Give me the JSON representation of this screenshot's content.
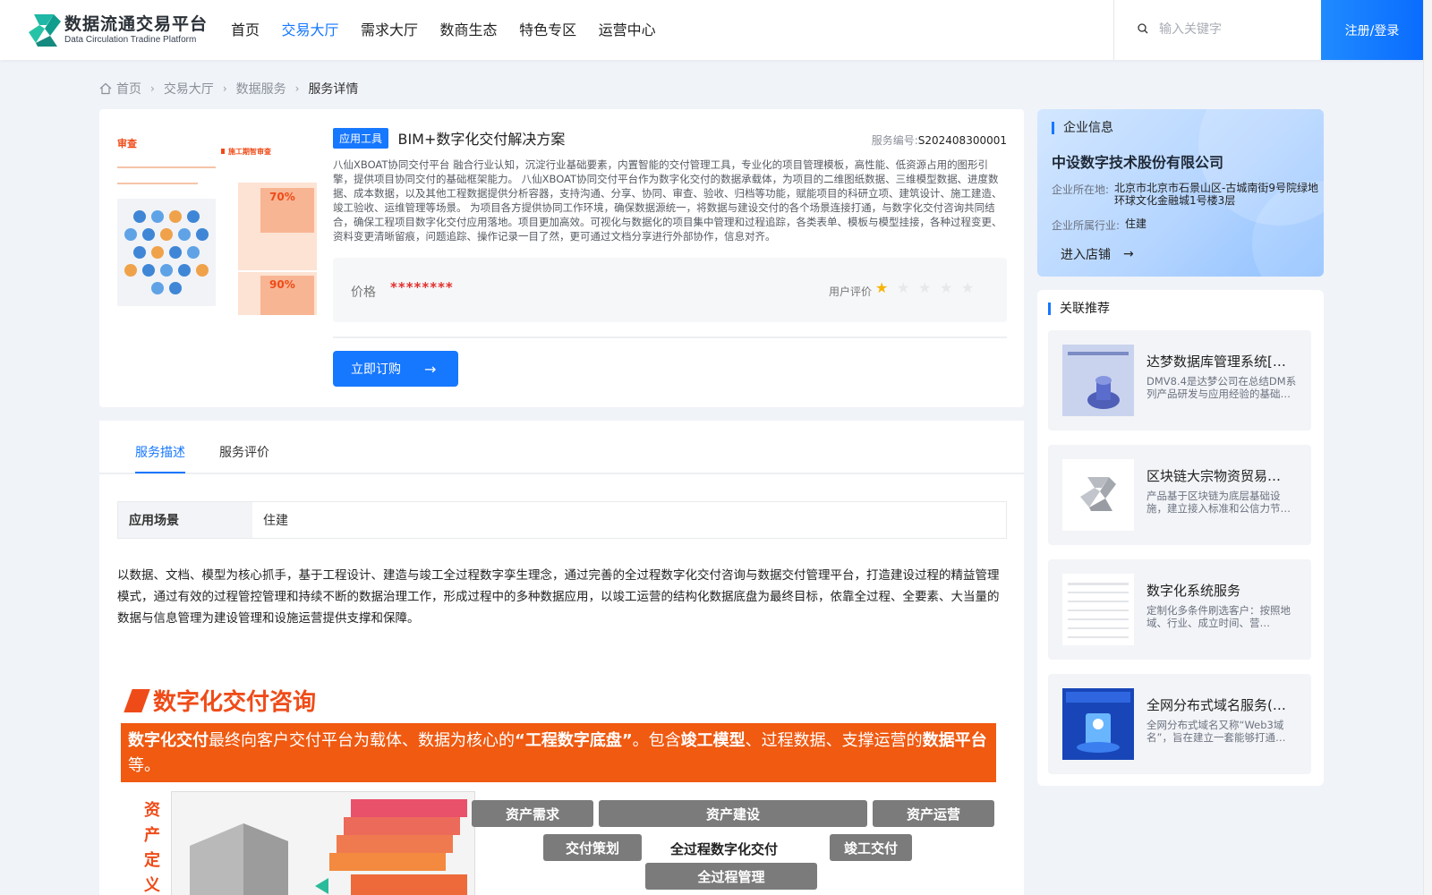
{
  "header": {
    "logo_title": "数据流通交易平台",
    "logo_subtitle": "Data Circulation Tradine Platform",
    "nav": [
      {
        "label": "首页",
        "active": false
      },
      {
        "label": "交易大厅",
        "active": true
      },
      {
        "label": "需求大厅",
        "active": false
      },
      {
        "label": "数商生态",
        "active": false
      },
      {
        "label": "特色专区",
        "active": false
      },
      {
        "label": "运营中心",
        "active": false
      }
    ],
    "search_placeholder": "输入关键字",
    "login_label": "注册/登录",
    "accent_color": "#1677ff"
  },
  "breadcrumb": [
    "首页",
    "交易大厅",
    "数据服务",
    "服务详情"
  ],
  "product": {
    "tag": "应用工具",
    "title": "BIM+数字化交付解决方案",
    "service_no_label": "服务编号:",
    "service_no": "S202408300001",
    "description": "八仙XBOAT协同交付平台 融合行业认知，沉淀行业基础要素，内置智能的交付管理工具，专业化的项目管理模板，高性能、低资源占用的图形引擎，提供项目协同交付的基础框架能力。 八仙XBOAT协同交付平台作为数字化交付的数据承载体，为项目的二维图纸数据、三维模型数据、进度数据、成本数据，以及其他工程数据提供分析容器，支持沟通、分享、协同、审查、验收、归档等功能，赋能项目的科研立项、建筑设计、施工建造、竣工验收、运维管理等场景。 为项目各方提供协同工作环境，确保数据源统一，将数据与建设交付的各个场景连接打通，与数字化交付咨询共同结合，确保工程项目数字化交付应用落地。项目更加高效。可视化与数据化的项目集中管理和过程追踪，各类表单、模板与模型挂接，各种过程变更、资料变更清晰留痕，问题追踪、操作记录一目了然，更可通过文档分享进行外部协作，信息对齐。",
    "price_label": "价格",
    "price": "********",
    "rating_label": "用户评价",
    "rating": 1,
    "rating_max": 5,
    "buy_label": "立即订购",
    "thumb_texts": [
      "审查",
      "施工期智审查",
      "70%",
      "90%"
    ]
  },
  "details": {
    "tabs": [
      {
        "label": "服务描述",
        "active": true
      },
      {
        "label": "服务评价",
        "active": false
      }
    ],
    "scene_key": "应用场景",
    "scene_value": "住建",
    "long_description": "以数据、文档、模型为核心抓手，基于工程设计、建造与竣工全过程数字孪生理念，通过完善的全过程数字化交付咨询与数据交付管理平台，打造建设过程的精益管理模式，通过有效的过程管控管理和持续不断的数据治理工作，形成过程中的多种数据应用，以竣工运营的结构化数据底盘为最终目标，依靠全过程、全要素、大当量的数据与信息管理为建设管理和设施运营提供支撑和保障。",
    "poster": {
      "title": "数字化交付咨询",
      "banner_1": "数字化交付",
      "banner_2": "最终向客户交付平台为载体、数据为核心的",
      "banner_3": "“工程数字底盘”",
      "banner_4": "。包含",
      "banner_5": "竣工模型",
      "banner_6": "、过程数据、支撑运营的",
      "banner_7": "数据平台",
      "banner_8": "等。",
      "side_label": "资产定义",
      "blocks": [
        "资产需求",
        "资产建设",
        "资产运营",
        "交付策划",
        "全过程数字化交付",
        "竣工交付",
        "全过程管理"
      ]
    }
  },
  "company": {
    "section_title": "企业信息",
    "name": "中设数字技术股份有限公司",
    "location_label": "企业所在地:",
    "location": "北京市北京市石景山区-古城南街9号院绿地环球文化金融城1号楼3层",
    "industry_label": "企业所属行业:",
    "industry": "住建",
    "enter_shop": "进入店铺"
  },
  "related": {
    "section_title": "关联推荐",
    "items": [
      {
        "title": "达梦数据库管理系统[…",
        "desc": "DMV8.4是达梦公司在总结DM系列产品研发与应用经验的基础…",
        "icon": "dameng-thumb"
      },
      {
        "title": "区块链大宗物资贸易…",
        "desc": "产品基于区块链为底层基础设施，建立接入标准和公信力节…",
        "icon": "platform-logo-thumb"
      },
      {
        "title": "数字化系统服务",
        "desc": "定制化多条件刷选客户：按照地域、行业、成立时间、营…",
        "icon": "table-thumb"
      },
      {
        "title": "全网分布式域名服务(…",
        "desc": "全网分布式域名又称“Web3域名”，旨在建立一套能够打通…",
        "icon": "domain-thumb"
      }
    ]
  }
}
